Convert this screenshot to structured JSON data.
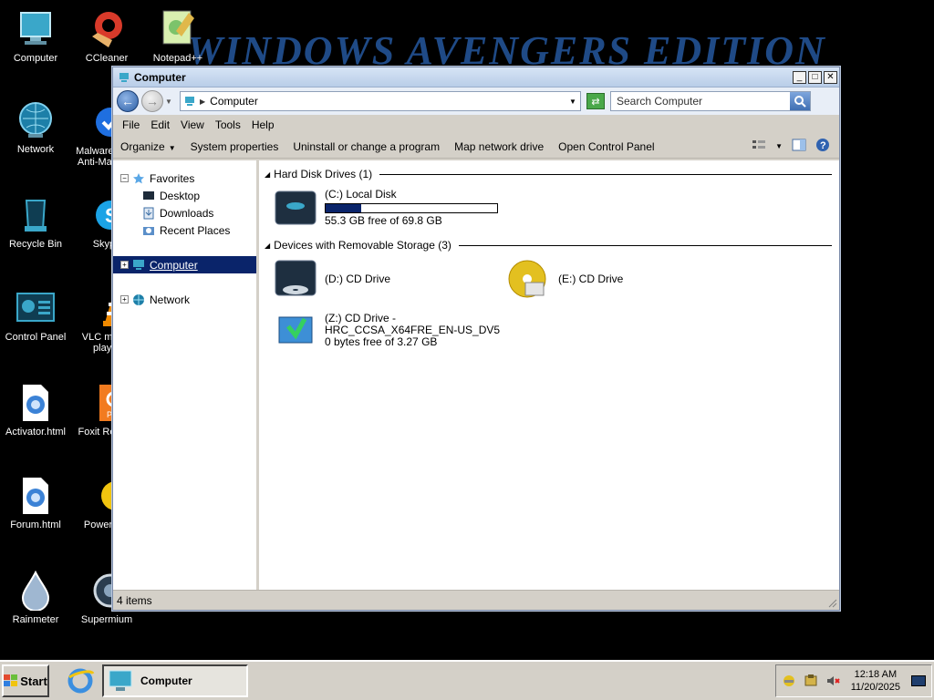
{
  "wallpaper": {
    "text": "WINDOWS AVENGERS EDITION"
  },
  "desktop": {
    "icons": [
      {
        "label": "Computer"
      },
      {
        "label": "CCleaner"
      },
      {
        "label": "Notepad++"
      },
      {
        "label": "Network"
      },
      {
        "label": "Malwarebytes Anti-Malware"
      },
      {
        "label": "Recycle Bin"
      },
      {
        "label": "Skype"
      },
      {
        "label": "Control Panel"
      },
      {
        "label": "VLC media player"
      },
      {
        "label": "Activator.html"
      },
      {
        "label": "Foxit Reader"
      },
      {
        "label": "Forum.html"
      },
      {
        "label": "PowerISO"
      },
      {
        "label": "Rainmeter"
      },
      {
        "label": "Supermium"
      }
    ]
  },
  "window": {
    "title": "Computer",
    "address": "Computer",
    "search_placeholder": "Search Computer",
    "menu": [
      "File",
      "Edit",
      "View",
      "Tools",
      "Help"
    ],
    "commands": {
      "organize": "Organize",
      "system_properties": "System properties",
      "uninstall": "Uninstall or change a program",
      "map_drive": "Map network drive",
      "control_panel": "Open Control Panel"
    },
    "nav": {
      "favorites": "Favorites",
      "desktop": "Desktop",
      "downloads": "Downloads",
      "recent": "Recent Places",
      "computer": "Computer",
      "network": "Network"
    },
    "groups": {
      "hdd_header": "Hard Disk Drives (1)",
      "removable_header": "Devices with Removable Storage (3)"
    },
    "drives": {
      "c": {
        "name": "(C:) Local Disk",
        "free": "55.3 GB free of 69.8 GB",
        "used_fraction": 0.208
      },
      "d": {
        "name": "(D:) CD Drive"
      },
      "e": {
        "name": "(E:) CD Drive"
      },
      "z": {
        "name": "(Z:) CD Drive -",
        "name2": "HRC_CCSA_X64FRE_EN-US_DV5",
        "free": "0 bytes free of 3.27 GB"
      }
    },
    "status": "4 items"
  },
  "taskbar": {
    "start": "Start",
    "task": "Computer",
    "time": "12:18 AM",
    "date": "11/20/2025"
  },
  "colors": {
    "selection": "#0a246a",
    "chrome": "#d4d0c8"
  }
}
